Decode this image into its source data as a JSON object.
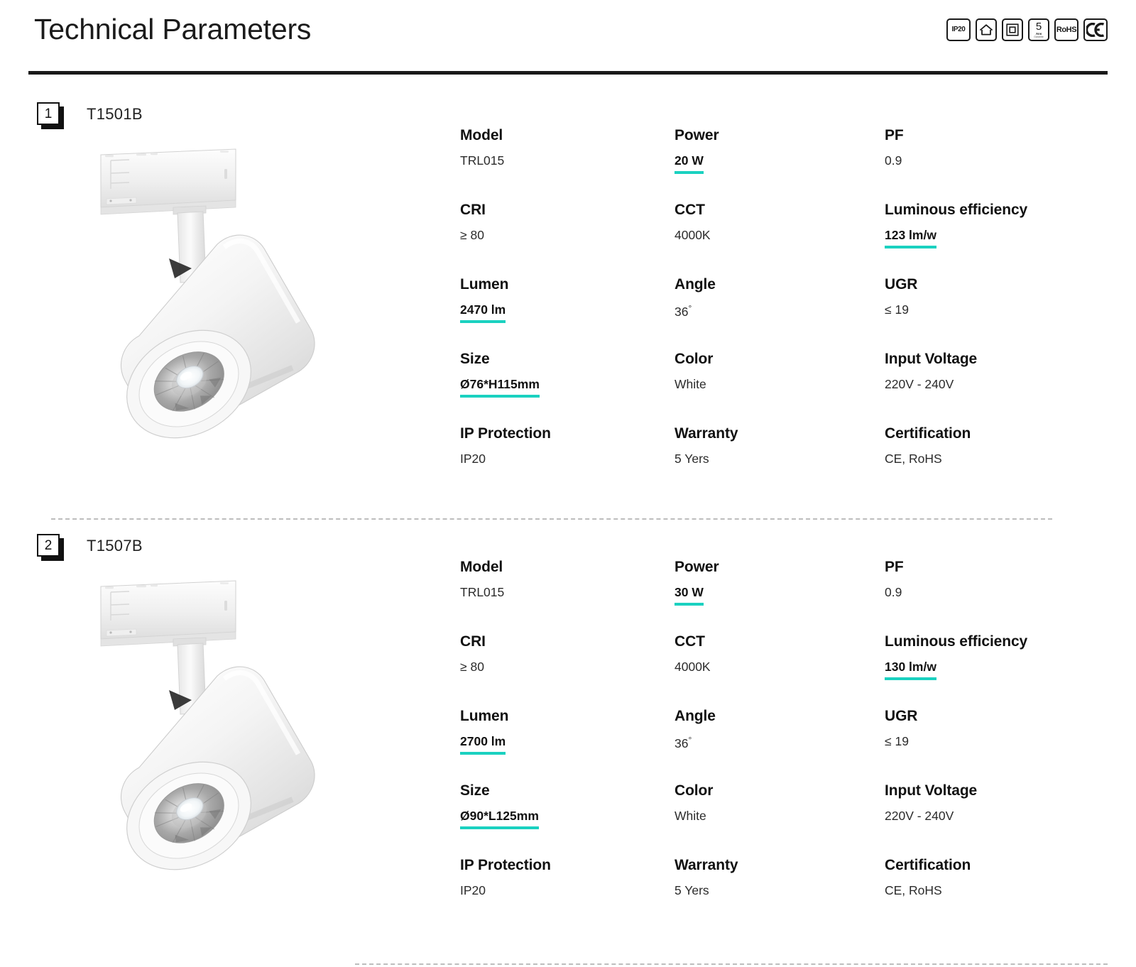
{
  "header": {
    "title": "Technical Parameters",
    "certifications": [
      {
        "name": "ip20-badge",
        "text": "IP20"
      },
      {
        "name": "indoor-house-badge",
        "text": ""
      },
      {
        "name": "class-two-badge",
        "text": ""
      },
      {
        "name": "warranty-years-badge",
        "number": "5",
        "label": "Ans",
        "sub": "Garantie"
      },
      {
        "name": "rohs-badge",
        "text": "RoHS"
      },
      {
        "name": "ce-badge",
        "text": "CE"
      }
    ]
  },
  "accent_color": "#1ad1c0",
  "products": [
    {
      "index": "1",
      "code": "T1501B",
      "image_alt": "white-track-spotlight",
      "specs": [
        {
          "label": "Model",
          "value": "TRL015",
          "highlight": false
        },
        {
          "label": "Power",
          "value": "20 W",
          "highlight": true
        },
        {
          "label": "PF",
          "value": "0.9",
          "highlight": false
        },
        {
          "label": "CRI",
          "value": "≥ 80",
          "highlight": false
        },
        {
          "label": "CCT",
          "value": "4000K",
          "highlight": false
        },
        {
          "label": "Luminous efficiency",
          "value": "123 lm/w",
          "highlight": true
        },
        {
          "label": "Lumen",
          "value": "2470 lm",
          "highlight": true
        },
        {
          "label": "Angle",
          "value": "36",
          "highlight": false,
          "degree": true
        },
        {
          "label": "UGR",
          "value": "≤ 19",
          "highlight": false
        },
        {
          "label": "Size",
          "value": "Ø76*H115mm",
          "highlight": true
        },
        {
          "label": "Color",
          "value": "White",
          "highlight": false
        },
        {
          "label": "Input Voltage",
          "value": "220V - 240V",
          "highlight": false
        },
        {
          "label": "IP Protection",
          "value": "IP20",
          "highlight": false
        },
        {
          "label": "Warranty",
          "value": "5 Yers",
          "highlight": false
        },
        {
          "label": "Certification",
          "value": "CE, RoHS",
          "highlight": false
        }
      ]
    },
    {
      "index": "2",
      "code": "T1507B",
      "image_alt": "white-track-spotlight",
      "specs": [
        {
          "label": "Model",
          "value": "TRL015",
          "highlight": false
        },
        {
          "label": "Power",
          "value": "30 W",
          "highlight": true
        },
        {
          "label": "PF",
          "value": "0.9",
          "highlight": false
        },
        {
          "label": "CRI",
          "value": "≥ 80",
          "highlight": false
        },
        {
          "label": "CCT",
          "value": "4000K",
          "highlight": false
        },
        {
          "label": "Luminous efficiency",
          "value": "130 lm/w",
          "highlight": true
        },
        {
          "label": "Lumen",
          "value": "2700 lm",
          "highlight": true
        },
        {
          "label": "Angle",
          "value": "36",
          "highlight": false,
          "degree": true
        },
        {
          "label": "UGR",
          "value": "≤ 19",
          "highlight": false
        },
        {
          "label": "Size",
          "value": "Ø90*L125mm",
          "highlight": true
        },
        {
          "label": "Color",
          "value": "White",
          "highlight": false
        },
        {
          "label": "Input Voltage",
          "value": "220V - 240V",
          "highlight": false
        },
        {
          "label": "IP Protection",
          "value": "IP20",
          "highlight": false
        },
        {
          "label": "Warranty",
          "value": "5 Yers",
          "highlight": false
        },
        {
          "label": "Certification",
          "value": "CE, RoHS",
          "highlight": false
        }
      ]
    }
  ]
}
